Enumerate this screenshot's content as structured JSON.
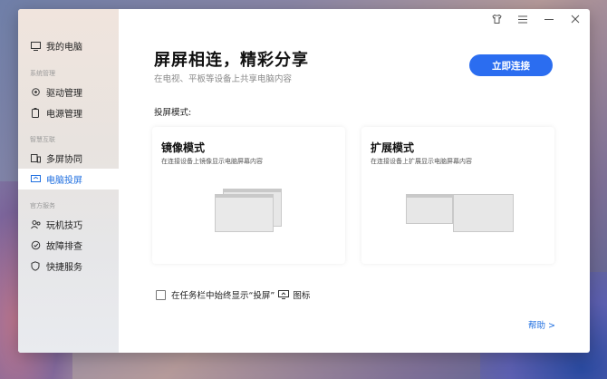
{
  "sidebar": {
    "items": [
      {
        "label": "我的电脑",
        "icon": "monitor-icon"
      },
      {
        "label": "驱动管理",
        "icon": "gear-icon"
      },
      {
        "label": "电源管理",
        "icon": "battery-icon"
      },
      {
        "label": "多屏协同",
        "icon": "multi-screen-icon"
      },
      {
        "label": "电脑投屏",
        "icon": "cast-icon"
      },
      {
        "label": "玩机技巧",
        "icon": "people-icon"
      },
      {
        "label": "故障排查",
        "icon": "wrench-icon"
      },
      {
        "label": "快捷服务",
        "icon": "shield-icon"
      }
    ],
    "sections": [
      "系统管理",
      "智慧互联",
      "官方服务"
    ],
    "active": "电脑投屏"
  },
  "titlebar": {
    "icons": [
      "shirt-icon",
      "menu-icon",
      "minimize-icon",
      "close-icon"
    ]
  },
  "main": {
    "title": "屏屏相连，精彩分享",
    "subtitle": "在电视、平板等设备上共享电脑内容",
    "connect_button": "立即连接",
    "section_label": "投屏模式:",
    "cards": [
      {
        "title": "镜像模式",
        "desc": "在连接设备上镜像显示电脑屏幕内容"
      },
      {
        "title": "扩展模式",
        "desc": "在连接设备上扩展显示电脑屏幕内容"
      }
    ],
    "taskbar_option": {
      "label_prefix": "在任务栏中始终显示",
      "label_quote": "“投屏”",
      "label_suffix": "图标",
      "checked": false
    },
    "help_link": "帮助 >"
  },
  "colors": {
    "accent": "#2b6df0",
    "active_text": "#1f6fe0"
  }
}
